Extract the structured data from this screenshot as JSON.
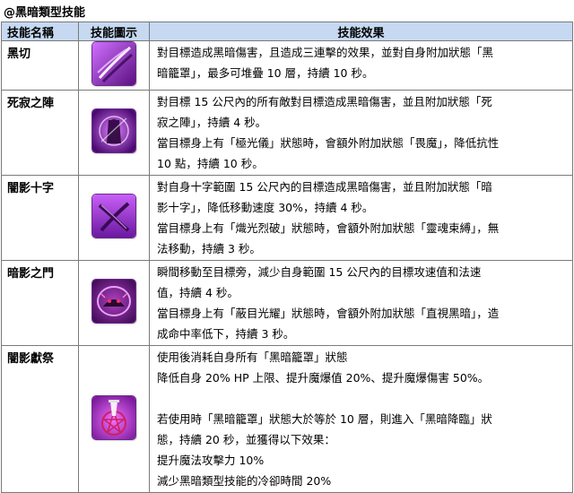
{
  "title": "@黑暗類型技能",
  "headers": {
    "name": "技能名稱",
    "icon": "技能圖示",
    "effect": "技能效果"
  },
  "skills": [
    {
      "name": "黑切",
      "icon": "dark-slash-icon",
      "lines": [
        "對目標造成黑暗傷害，且造成三連擊的效果，並對自身附加狀態「黑",
        "暗籠罩」，最多可堆疊 10 層，持續 10 秒。"
      ]
    },
    {
      "name": "死寂之陣",
      "icon": "death-formation-icon",
      "lines": [
        "對目標 15 公尺內的所有敵對目標造成黑暗傷害，並且附加狀態「死",
        "寂之陣」，持續 4 秒。",
        "當目標身上有「極光儀」狀態時，會額外附加狀態「畏魔」，降低抗性",
        "10 點，持續 10 秒。"
      ]
    },
    {
      "name": "闇影十字",
      "icon": "shadow-cross-icon",
      "lines": [
        "對自身十字範圍 15 公尺內的目標造成黑暗傷害，並且附加狀態「暗",
        "影十字」，降低移動速度 30%，持續 4 秒。",
        "當目標身上有「熾光烈破」狀態時，會額外附加狀態「靈魂束縛」，無",
        "法移動，持續 3 秒。"
      ]
    },
    {
      "name": "暗影之門",
      "icon": "shadow-gate-icon",
      "lines": [
        "瞬間移動至目標旁，減少自身範圍 15 公尺內的目標攻速值和法速",
        "值，持續 4 秒。",
        "當目標身上有「蔽目光耀」狀態時，會額外附加狀態「直視黑暗」，造",
        "成命中率低下，持續 3 秒。"
      ]
    },
    {
      "name": "闇影獻祭",
      "icon": "shadow-sacrifice-icon",
      "lines": [
        "使用後消耗自身所有「黑暗籠罩」狀態",
        "降低自身 20% HP 上限、提升魔爆值 20%、提升魔爆傷害 50%。",
        "",
        "若使用時「黑暗籠罩」狀態大於等於 10 層，則進入「黑暗降臨」狀",
        "態，持續 20 秒，並獲得以下效果：",
        "提升魔法攻擊力 10%",
        "減少黑暗類型技能的冷卻時間 20%"
      ]
    }
  ]
}
